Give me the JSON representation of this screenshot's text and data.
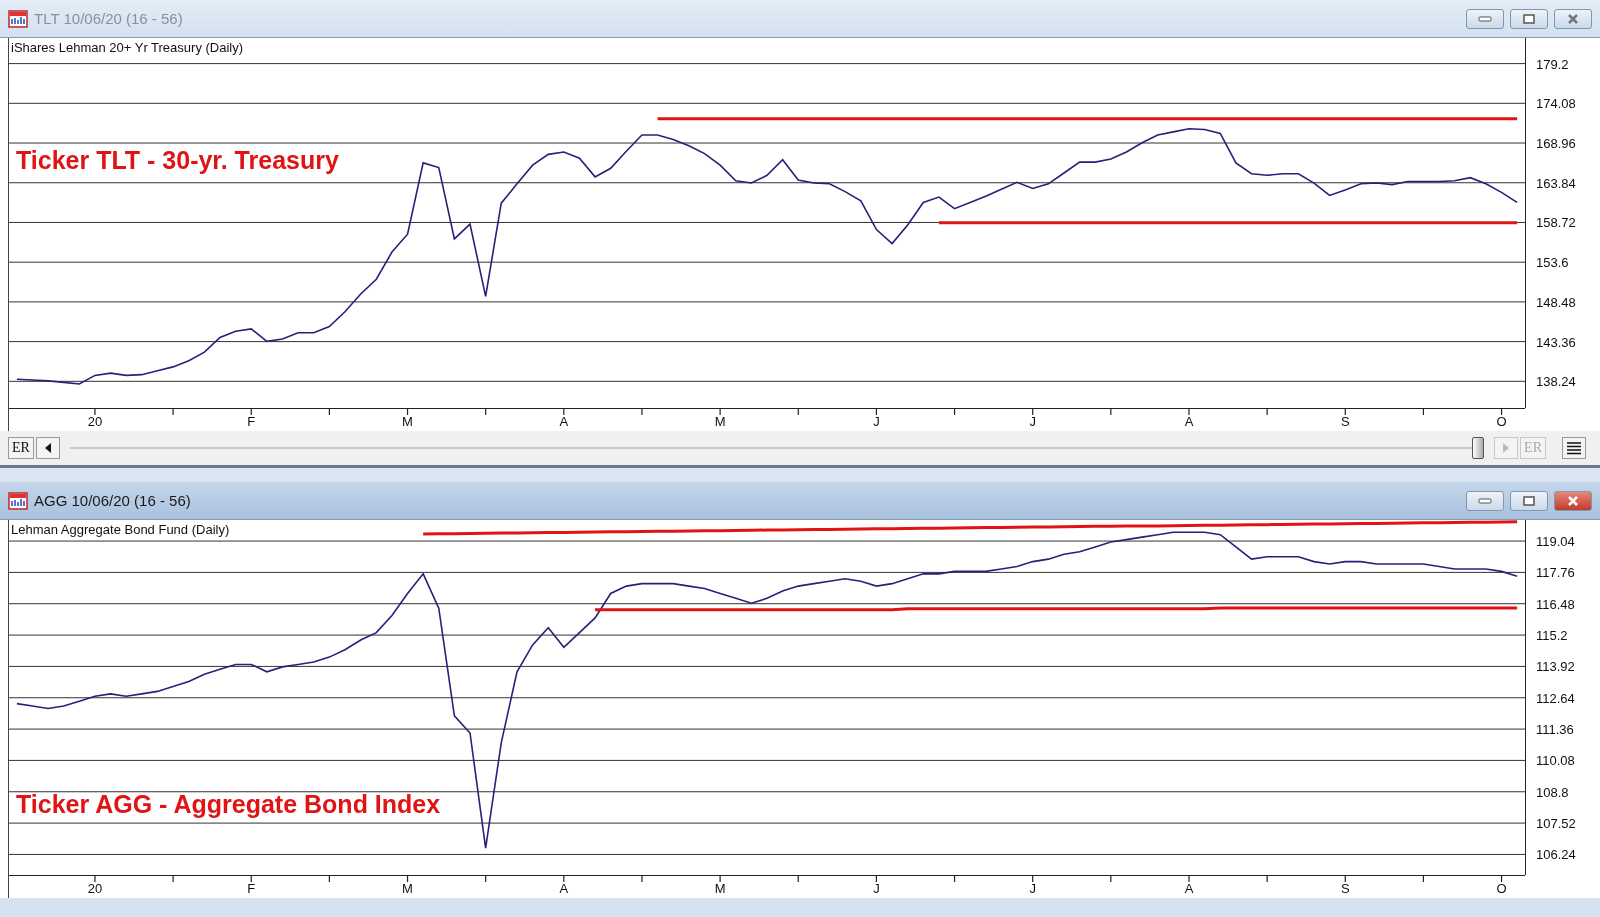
{
  "windows": [
    {
      "title": "TLT 10/06/20 (16 - 56)",
      "active": false,
      "chart_data": {
        "type": "line",
        "title": "iShares Lehman 20+ Yr Treasury (Daily)",
        "ylim": [
          134.8,
          182.5
        ],
        "categories": [
          null,
          null,
          null,
          null,
          null,
          "20",
          null,
          null,
          null,
          null,
          null,
          null,
          null,
          null,
          null,
          "F",
          null,
          null,
          null,
          null,
          null,
          null,
          null,
          null,
          null,
          "M",
          null,
          null,
          null,
          null,
          null,
          null,
          null,
          null,
          null,
          "A",
          null,
          null,
          null,
          null,
          null,
          null,
          null,
          null,
          null,
          "M",
          null,
          null,
          null,
          null,
          null,
          null,
          null,
          null,
          null,
          "J",
          null,
          null,
          null,
          null,
          null,
          null,
          null,
          null,
          null,
          "J",
          null,
          null,
          null,
          null,
          null,
          null,
          null,
          null,
          null,
          "A",
          null,
          null,
          null,
          null,
          null,
          null,
          null,
          null,
          null,
          "S",
          null,
          null,
          null,
          null,
          null,
          null,
          null,
          null,
          null,
          "O",
          null
        ],
        "series": [
          {
            "color": "#2a1f7a",
            "values": [
              138.5,
              138.4,
              138.3,
              138.1,
              137.9,
              139,
              139.3,
              139,
              139.1,
              139.6,
              140.1,
              140.9,
              142,
              143.9,
              144.7,
              145,
              143.4,
              143.7,
              144.5,
              144.5,
              145.3,
              147.2,
              149.5,
              151.4,
              154.9,
              157.2,
              166.4,
              165.8,
              156.6,
              158.5,
              149.2,
              161.2,
              163.7,
              166.1,
              167.5,
              167.8,
              167,
              164.6,
              165.7,
              167.9,
              170,
              170,
              169.4,
              168.6,
              167.6,
              166.1,
              164.1,
              163.8,
              164.8,
              166.8,
              164.2,
              163.8,
              163.7,
              162.7,
              161.5,
              157.8,
              156,
              158.4,
              161.3,
              162,
              160.5,
              161.3,
              162.1,
              163,
              163.9,
              163.1,
              163.7,
              165.1,
              166.5,
              166.5,
              166.9,
              167.8,
              169,
              170,
              170.4,
              170.8,
              170.7,
              170.2,
              166.4,
              165,
              164.8,
              165,
              165,
              163.8,
              162.2,
              162.9,
              163.7,
              163.8,
              163.6,
              164,
              164,
              164,
              164.1,
              164.5,
              163.7,
              162.6,
              161.3
            ]
          },
          {
            "color": "#e01414",
            "values": [
              null,
              null,
              null,
              null,
              null,
              null,
              null,
              null,
              null,
              null,
              null,
              null,
              null,
              null,
              null,
              null,
              null,
              null,
              null,
              null,
              null,
              null,
              null,
              null,
              null,
              null,
              null,
              null,
              null,
              null,
              null,
              null,
              null,
              null,
              null,
              null,
              null,
              null,
              null,
              null,
              null,
              172.1,
              172.1,
              172.1,
              172.1,
              172.1,
              172.1,
              172.1,
              172.1,
              172.1,
              172.1,
              172.1,
              172.1,
              172.1,
              172.1,
              172.1,
              172.1,
              172.1,
              172.1,
              172.1,
              172.1,
              172.1,
              172.1,
              172.1,
              172.1,
              172.1,
              172.1,
              172.1,
              172.1,
              172.1,
              172.1,
              172.1,
              172.1,
              172.1,
              172.1,
              172.1,
              172.1,
              172.1,
              172.1,
              172.1,
              172.1,
              172.1,
              172.1,
              172.1,
              172.1,
              172.1,
              172.1,
              172.1,
              172.1,
              172.1,
              172.1,
              172.1,
              172.1,
              172.1,
              172.1,
              172.1,
              172.1
            ]
          },
          {
            "color": "#e01414",
            "values": [
              null,
              null,
              null,
              null,
              null,
              null,
              null,
              null,
              null,
              null,
              null,
              null,
              null,
              null,
              null,
              null,
              null,
              null,
              null,
              null,
              null,
              null,
              null,
              null,
              null,
              null,
              null,
              null,
              null,
              null,
              null,
              null,
              null,
              null,
              null,
              null,
              null,
              null,
              null,
              null,
              null,
              null,
              null,
              null,
              null,
              null,
              null,
              null,
              null,
              null,
              null,
              null,
              null,
              null,
              null,
              null,
              null,
              null,
              null,
              158.7,
              158.7,
              158.7,
              158.7,
              158.7,
              158.7,
              158.7,
              158.7,
              158.7,
              158.7,
              158.7,
              158.7,
              158.7,
              158.7,
              158.7,
              158.7,
              158.7,
              158.7,
              158.7,
              158.7,
              158.7,
              158.7,
              158.7,
              158.7,
              158.7,
              158.7,
              158.7,
              158.7,
              158.7,
              158.7,
              158.7,
              158.7,
              158.7,
              158.7,
              158.7,
              158.7,
              158.7,
              158.7
            ]
          }
        ],
        "yticks": [
          179.2,
          174.08,
          168.96,
          163.84,
          158.72,
          153.6,
          148.48,
          143.36,
          138.24
        ],
        "grid": true,
        "annotations": [
          "Ticker TLT - 30-yr. Treasury"
        ]
      },
      "scroll_buttons": [
        {
          "label": "ER",
          "disabled": false
        },
        {
          "label": "ER",
          "disabled": true
        }
      ]
    },
    {
      "title": "AGG 10/06/20 (16 - 56)",
      "active": true,
      "chart_data": {
        "type": "line",
        "title": "Lehman Aggregate Bond Fund (Daily)",
        "ylim": [
          105.4,
          119.9
        ],
        "categories": [
          null,
          null,
          null,
          null,
          null,
          "20",
          null,
          null,
          null,
          null,
          null,
          null,
          null,
          null,
          null,
          "F",
          null,
          null,
          null,
          null,
          null,
          null,
          null,
          null,
          null,
          "M",
          null,
          null,
          null,
          null,
          null,
          null,
          null,
          null,
          null,
          "A",
          null,
          null,
          null,
          null,
          null,
          null,
          null,
          null,
          null,
          "M",
          null,
          null,
          null,
          null,
          null,
          null,
          null,
          null,
          null,
          "J",
          null,
          null,
          null,
          null,
          null,
          null,
          null,
          null,
          null,
          "J",
          null,
          null,
          null,
          null,
          null,
          null,
          null,
          null,
          null,
          "A",
          null,
          null,
          null,
          null,
          null,
          null,
          null,
          null,
          null,
          "S",
          null,
          null,
          null,
          null,
          null,
          null,
          null,
          null,
          null,
          "O",
          null
        ],
        "series": [
          {
            "color": "#2a1f7a",
            "values": [
              112.4,
              112.3,
              112.2,
              112.3,
              112.5,
              112.7,
              112.8,
              112.7,
              112.8,
              112.9,
              113.1,
              113.3,
              113.6,
              113.8,
              114,
              114,
              113.7,
              113.9,
              114,
              114.1,
              114.3,
              114.6,
              115,
              115.3,
              116,
              116.9,
              117.7,
              116.3,
              111.9,
              111.2,
              106.5,
              110.8,
              113.7,
              114.8,
              115.5,
              114.7,
              115.3,
              115.9,
              116.9,
              117.2,
              117.3,
              117.3,
              117.3,
              117.2,
              117.1,
              116.9,
              116.7,
              116.5,
              116.7,
              117,
              117.2,
              117.3,
              117.4,
              117.5,
              117.4,
              117.2,
              117.3,
              117.5,
              117.7,
              117.7,
              117.8,
              117.8,
              117.8,
              117.9,
              118,
              118.2,
              118.3,
              118.5,
              118.6,
              118.8,
              119,
              119.1,
              119.2,
              119.3,
              119.4,
              119.4,
              119.4,
              119.3,
              118.8,
              118.3,
              118.4,
              118.4,
              118.4,
              118.2,
              118.1,
              118.2,
              118.2,
              118.1,
              118.1,
              118.1,
              118.1,
              118,
              117.9,
              117.9,
              117.9,
              117.8,
              117.6
            ]
          },
          {
            "color": "#e01414",
            "values": [
              null,
              null,
              null,
              null,
              null,
              null,
              null,
              null,
              null,
              null,
              null,
              null,
              null,
              null,
              null,
              null,
              null,
              null,
              null,
              null,
              null,
              null,
              null,
              null,
              null,
              null,
              119.33,
              119.34,
              119.34,
              119.35,
              119.36,
              119.37,
              119.37,
              119.38,
              119.39,
              119.39,
              119.4,
              119.41,
              119.42,
              119.42,
              119.43,
              119.44,
              119.44,
              119.45,
              119.46,
              119.46,
              119.47,
              119.48,
              119.49,
              119.49,
              119.5,
              119.51,
              119.51,
              119.52,
              119.53,
              119.54,
              119.54,
              119.55,
              119.56,
              119.56,
              119.57,
              119.58,
              119.59,
              119.59,
              119.6,
              119.61,
              119.61,
              119.62,
              119.63,
              119.64,
              119.64,
              119.65,
              119.66,
              119.66,
              119.67,
              119.68,
              119.69,
              119.69,
              119.7,
              119.71,
              119.71,
              119.72,
              119.73,
              119.74,
              119.74,
              119.75,
              119.76,
              119.76,
              119.77,
              119.78,
              119.79,
              119.79,
              119.8,
              119.81,
              119.81,
              119.82,
              119.83
            ]
          },
          {
            "color": "#e01414",
            "values": [
              null,
              null,
              null,
              null,
              null,
              null,
              null,
              null,
              null,
              null,
              null,
              null,
              null,
              null,
              null,
              null,
              null,
              null,
              null,
              null,
              null,
              null,
              null,
              null,
              null,
              null,
              null,
              null,
              null,
              null,
              null,
              null,
              null,
              null,
              null,
              null,
              null,
              116.23,
              116.23,
              116.23,
              116.23,
              116.23,
              116.23,
              116.23,
              116.23,
              116.23,
              116.23,
              116.23,
              116.23,
              116.23,
              116.23,
              116.23,
              116.23,
              116.23,
              116.23,
              116.23,
              116.23,
              116.27,
              116.27,
              116.27,
              116.27,
              116.27,
              116.27,
              116.27,
              116.27,
              116.27,
              116.27,
              116.27,
              116.27,
              116.27,
              116.27,
              116.27,
              116.27,
              116.27,
              116.27,
              116.27,
              116.27,
              116.31,
              116.31,
              116.31,
              116.31,
              116.31,
              116.31,
              116.31,
              116.31,
              116.31,
              116.31,
              116.31,
              116.31,
              116.31,
              116.31,
              116.31,
              116.31,
              116.31,
              116.31,
              116.31,
              116.31
            ]
          }
        ],
        "yticks": [
          119.04,
          117.76,
          116.48,
          115.2,
          113.92,
          112.64,
          111.36,
          110.08,
          108.8,
          107.52,
          106.24
        ],
        "grid": true,
        "annotations": [
          "Ticker AGG - Aggregate Bond Index"
        ]
      }
    }
  ]
}
